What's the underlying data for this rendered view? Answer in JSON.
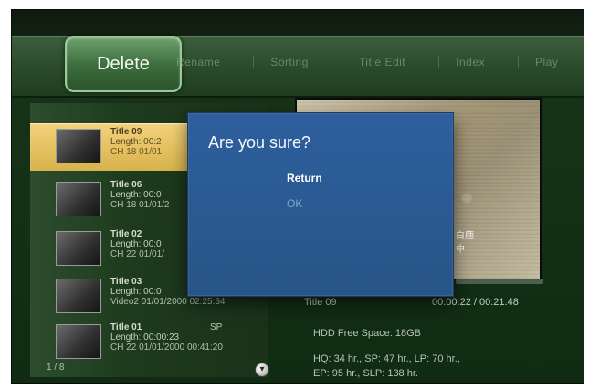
{
  "toolbar": {
    "delete_label": "Delete",
    "tabs": [
      {
        "label": "Rename"
      },
      {
        "label": "Sorting"
      },
      {
        "label": "Title Edit"
      },
      {
        "label": "Index"
      },
      {
        "label": "Play"
      }
    ]
  },
  "recordings": [
    {
      "title": "Title 09",
      "length": "Length: 00:2",
      "channel": "CH 18 01/01",
      "selected": true
    },
    {
      "title": "Title 06",
      "length": "Length: 00:0",
      "channel": "CH 18 01/01/2",
      "selected": false
    },
    {
      "title": "Title 02",
      "length": "Length: 00:0",
      "channel": "CH 22 01/01/",
      "selected": false
    },
    {
      "title": "Title 03",
      "length": "Length: 00:0",
      "channel": "Video2 01/01/2000 02:25:34",
      "selected": false
    },
    {
      "title": "Title 01",
      "length": "Length: 00:00:23",
      "channel": "CH 22 01/01/2000 00:41:20",
      "extra": "SP",
      "selected": false
    }
  ],
  "list": {
    "pager": "1 / 8"
  },
  "preview": {
    "osd_text": "白鹿\n中",
    "bar_present": true
  },
  "info": {
    "title": "Title 09",
    "time": "00:00:22 / 00:21:48",
    "hdd_free": "HDD Free Space: 18GB",
    "quality_line_1": "HQ: 34 hr.,     SP: 47 hr.,     LP: 70 hr.,",
    "quality_line_2": "EP: 95 hr.,     SLP: 138 hr."
  },
  "dialog": {
    "title": "Are you sure?",
    "options": [
      {
        "label": "Return",
        "selected": true
      },
      {
        "label": "OK",
        "selected": false
      }
    ]
  },
  "colors": {
    "screen_bg": "#173317",
    "toolbar_bg": "#2c4e2c",
    "selected_row": "#d8b24a",
    "dialog_bg": "#2e5f9d"
  },
  "icons": {
    "scroll": "down-scroll-icon"
  }
}
